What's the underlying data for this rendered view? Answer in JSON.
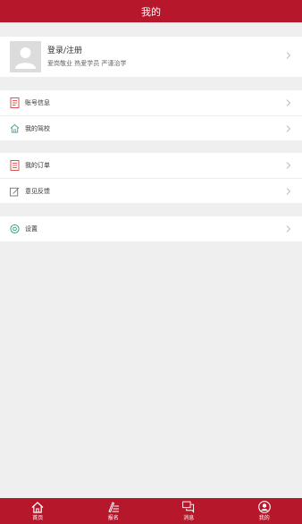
{
  "header": {
    "title": "我的"
  },
  "profile": {
    "login_label": "登录/注册",
    "motto": "爱岗敬业 热爱学员 严谨治学",
    "avatar_icon": "user-placeholder-icon"
  },
  "groups": [
    {
      "items": [
        {
          "label": "账号信息",
          "icon": "document-icon"
        },
        {
          "label": "我的驾校",
          "icon": "home-icon"
        }
      ]
    },
    {
      "items": [
        {
          "label": "我的订单",
          "icon": "order-list-icon"
        },
        {
          "label": "意见反馈",
          "icon": "edit-icon"
        }
      ]
    },
    {
      "items": [
        {
          "label": "设置",
          "icon": "gear-icon"
        }
      ]
    }
  ],
  "tabbar": {
    "tabs": [
      {
        "label": "首页",
        "icon": "home-icon"
      },
      {
        "label": "报名",
        "icon": "signup-icon"
      },
      {
        "label": "消息",
        "icon": "message-icon"
      },
      {
        "label": "我的",
        "icon": "profile-icon",
        "active": true
      }
    ]
  },
  "colors": {
    "brand": "#b7172b",
    "icon_red": "#d9534f",
    "icon_teal": "#3aa7a0",
    "icon_gray": "#777777",
    "icon_green": "#2e9b7a"
  }
}
